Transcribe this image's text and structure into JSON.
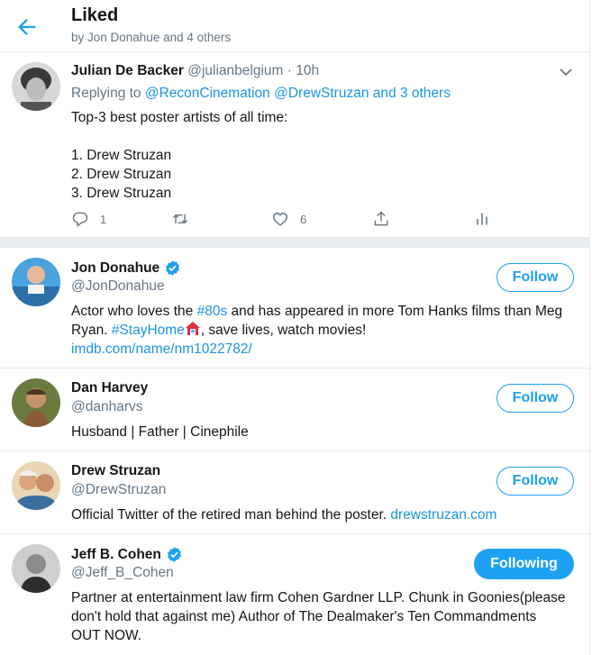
{
  "header": {
    "title": "Liked",
    "subtitle": "by Jon Donahue and 4 others"
  },
  "tweet": {
    "author_name": "Julian De Backer",
    "author_handle": "@julianbelgium",
    "separator": "·",
    "time": "10h",
    "replying_to_prefix": "Replying to",
    "replying_to_link1": "@ReconCinemation",
    "replying_to_link2": "@DrewStruzan",
    "replying_to_and": "and",
    "replying_to_others": "3 others",
    "text": "Top-3 best poster artists of all time:\n\n1. Drew Struzan\n2. Drew Struzan\n3. Drew Struzan",
    "reply_count": "1",
    "like_count": "6"
  },
  "users": [
    {
      "name": "Jon Donahue",
      "handle": "@JonDonahue",
      "verified": true,
      "button": "Follow",
      "bio_parts": [
        "Actor who loves the ",
        "#80s",
        " and has appeared in more Tom Hanks films than Meg Ryan. ",
        "#StayHome",
        ", save lives, watch movies!"
      ],
      "bio_url": "imdb.com/name/nm1022782/"
    },
    {
      "name": "Dan Harvey",
      "handle": "@danharvs",
      "verified": false,
      "button": "Follow",
      "bio": "Husband | Father | Cinephile"
    },
    {
      "name": "Drew Struzan",
      "handle": "@DrewStruzan",
      "verified": false,
      "button": "Follow",
      "bio_text": "Official Twitter of the retired man behind the poster. ",
      "bio_url": "drewstruzan.com"
    },
    {
      "name": "Jeff B. Cohen",
      "handle": "@Jeff_B_Cohen",
      "verified": true,
      "button": "Following",
      "bio": "Partner at entertainment law firm Cohen Gardner LLP. Chunk in Goonies(please don't hold that against me) Author of The Dealmaker's Ten Commandments OUT NOW."
    }
  ],
  "colors": {
    "accent": "#1da1f2",
    "link": "#1b95e0",
    "muted": "#657786",
    "divider": "#e6ecf0"
  },
  "icons": [
    "back-arrow-icon",
    "chevron-down-icon",
    "reply-icon",
    "retweet-icon",
    "like-icon",
    "share-icon",
    "analytics-icon",
    "verified-badge-icon",
    "house-emoji-icon"
  ]
}
